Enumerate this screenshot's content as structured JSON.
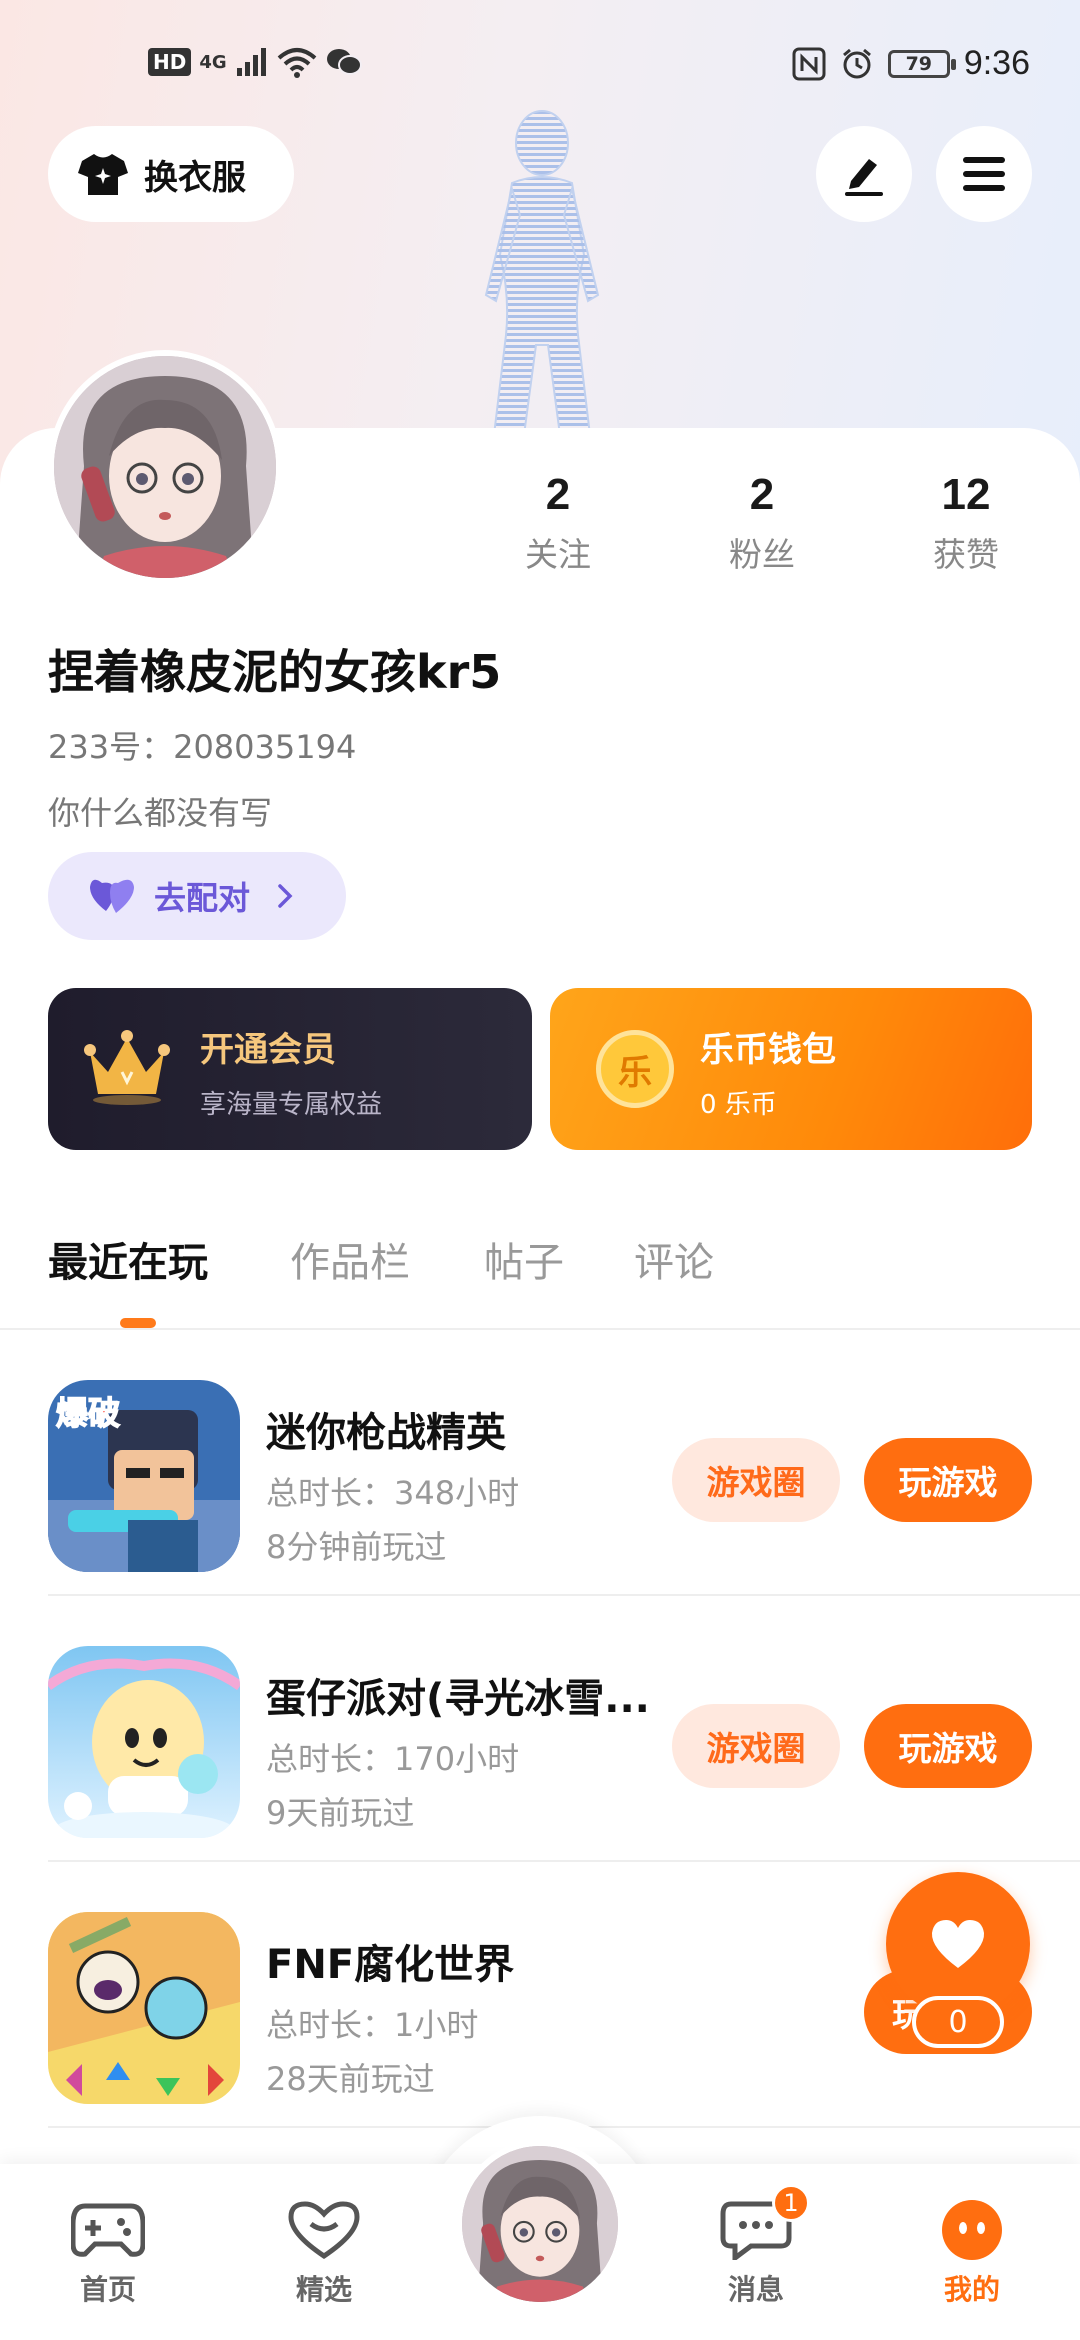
{
  "status_bar": {
    "hd": "HD",
    "network": "4G",
    "battery": "79",
    "time": "9:36"
  },
  "header": {
    "outfit_label": "换衣服"
  },
  "profile": {
    "username": "捏着橡皮泥的女孩kr5",
    "uid": "233号：208035194",
    "bio": "你什么都没有写",
    "match_label": "去配对",
    "stats": [
      {
        "value": "2",
        "label": "关注"
      },
      {
        "value": "2",
        "label": "粉丝"
      },
      {
        "value": "12",
        "label": "获赞"
      }
    ]
  },
  "vip": {
    "title": "开通会员",
    "subtitle": "享海量专属权益"
  },
  "wallet": {
    "title": "乐币钱包",
    "subtitle": "0 乐币",
    "coin_glyph": "乐"
  },
  "tabs": [
    {
      "label": "最近在玩"
    },
    {
      "label": "作品栏"
    },
    {
      "label": "帖子"
    },
    {
      "label": "评论"
    }
  ],
  "games": [
    {
      "name": "迷你枪战精英",
      "duration": "总时长：348小时",
      "last_played": "8分钟前玩过",
      "circle_label": "游戏圈",
      "play_label": "玩游戏",
      "icon_text": "爆破"
    },
    {
      "name": "蛋仔派对(寻光冰雪...",
      "duration": "总时长：170小时",
      "last_played": "9天前玩过",
      "circle_label": "游戏圈",
      "play_label": "玩游戏"
    },
    {
      "name": "FNF腐化世界",
      "duration": "总时长：1小时",
      "last_played": "28天前玩过",
      "circle_label": "",
      "play_label": "玩"
    }
  ],
  "like": {
    "count": "0"
  },
  "bottom_nav": {
    "items": [
      {
        "label": "首页"
      },
      {
        "label": "精选"
      },
      {
        "label": "消息"
      },
      {
        "label": "我的"
      }
    ],
    "message_badge": "1"
  },
  "colors": {
    "accent": "#ff6e10",
    "match": "#6b58d8",
    "vip_gold": "#f6c77d"
  }
}
